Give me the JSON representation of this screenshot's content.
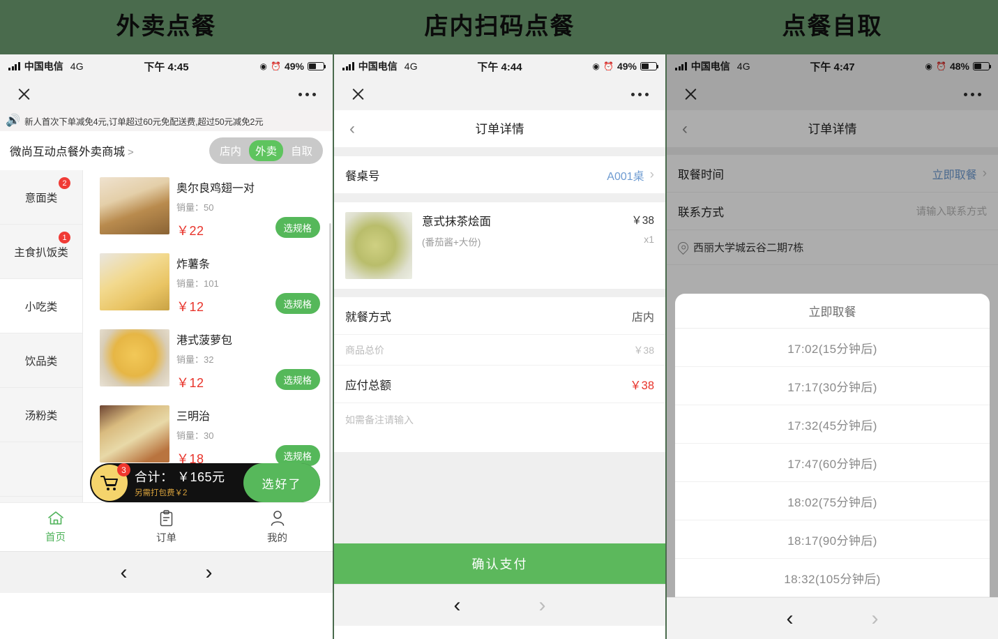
{
  "columns": [
    {
      "title": "外卖点餐"
    },
    {
      "title": "店内扫码点餐"
    },
    {
      "title": "点餐自取"
    }
  ],
  "statusbar": [
    {
      "carrier": "中国电信",
      "network": "4G",
      "time": "下午 4:45",
      "battery": "49%"
    },
    {
      "carrier": "中国电信",
      "network": "4G",
      "time": "下午 4:44",
      "battery": "49%"
    },
    {
      "carrier": "中国电信",
      "network": "4G",
      "time": "下午 4:47",
      "battery": "48%"
    }
  ],
  "takeaway": {
    "notice": "新人首次下单减免4元,订单超过60元免配送费,超过50元减免2元",
    "shop_name": "微尚互动点餐外卖商城",
    "shop_arrow": ">",
    "segments": [
      {
        "label": "店内",
        "active": false
      },
      {
        "label": "外卖",
        "active": true
      },
      {
        "label": "自取",
        "active": false
      }
    ],
    "categories": [
      {
        "label": "意面类",
        "badge": "2",
        "active": false
      },
      {
        "label": "主食扒饭类",
        "badge": "1",
        "active": false
      },
      {
        "label": "小吃类",
        "badge": "",
        "active": true
      },
      {
        "label": "饮品类",
        "badge": "",
        "active": false
      },
      {
        "label": "汤粉类",
        "badge": "",
        "active": false
      }
    ],
    "sold_label": "销量：",
    "spec_button": "选规格",
    "dishes": [
      {
        "name": "奥尔良鸡翅一对",
        "sold": "50",
        "price": "￥22"
      },
      {
        "name": "炸薯条",
        "sold": "101",
        "price": "￥12"
      },
      {
        "name": "港式菠萝包",
        "sold": "32",
        "price": "￥12"
      },
      {
        "name": "三明治",
        "sold": "30",
        "price": "￥18"
      }
    ],
    "cart": {
      "count": "3",
      "total_label": "合计：",
      "total": "￥165元",
      "subtext": "另需打包费￥2",
      "go_label": "选好了"
    },
    "tabs": [
      {
        "label": "首页",
        "icon": "home-icon",
        "active": true
      },
      {
        "label": "订单",
        "icon": "clipboard-icon",
        "active": false
      },
      {
        "label": "我的",
        "icon": "person-icon",
        "active": false
      }
    ]
  },
  "instore": {
    "nav_title": "订单详情",
    "table_label": "餐桌号",
    "table_value": "A001桌",
    "item": {
      "name": "意式抹茶烩面",
      "spec": "(番茄酱+大份)",
      "price": "￥38",
      "qty": "x1"
    },
    "dine_label": "就餐方式",
    "dine_value": "店内",
    "subtotal_label": "商品总价",
    "subtotal_value": "￥38",
    "total_label": "应付总额",
    "total_value": "￥38",
    "note_placeholder": "如需备注请输入",
    "pay_button": "确认支付"
  },
  "pickup": {
    "nav_title": "订单详情",
    "time_label": "取餐时间",
    "time_value": "立即取餐",
    "contact_label": "联系方式",
    "contact_placeholder": "请输入联系方式",
    "address": "西丽大学城云谷二期7栋",
    "sheet_title": "立即取餐",
    "sheet_options": [
      "17:02(15分钟后)",
      "17:17(30分钟后)",
      "17:32(45分钟后)",
      "17:47(60分钟后)",
      "18:02(75分钟后)",
      "18:17(90分钟后)",
      "18:32(105分钟后)"
    ]
  },
  "homebar": {
    "back": "‹",
    "forward": "›"
  },
  "colors": {
    "background": "#4a6b4d",
    "accent_green": "#5cb85c",
    "price_red": "#e8332a",
    "badge_red": "#f03b36",
    "cart_yellow": "#f5d46c",
    "link_blue": "#6e9bd1"
  }
}
